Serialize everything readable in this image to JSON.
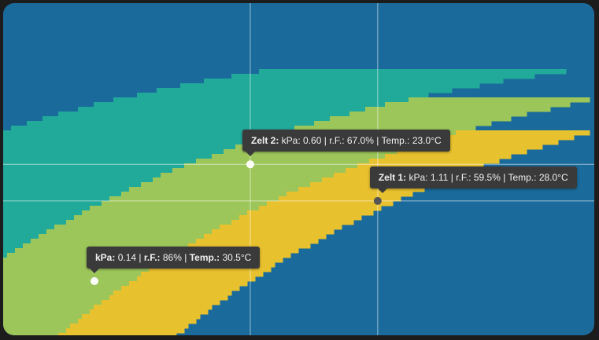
{
  "chart_data": {
    "type": "heatmap",
    "title": "",
    "xlabel": "",
    "ylabel": "",
    "x_variable": "Temp. (°C)",
    "y_variable": "r.F. (%)",
    "xlim": [
      13.3,
      36.5
    ],
    "ylim": [
      32,
      100
    ],
    "color_variable": "kPa",
    "bands": [
      {
        "color": "#1a6b9b",
        "vpd_range": [
          0.0,
          0.4
        ]
      },
      {
        "color": "#21a99a",
        "vpd_range": [
          0.4,
          0.8
        ]
      },
      {
        "color": "#9cc65a",
        "vpd_range": [
          0.8,
          1.2
        ]
      },
      {
        "color": "#e8c12e",
        "vpd_range": [
          1.2,
          1.6
        ]
      },
      {
        "color": "#cf4434",
        "vpd_range": [
          1.6,
          99
        ]
      }
    ],
    "points": [
      {
        "name": "Zelt 2",
        "kpa": 0.6,
        "rh": 67.0,
        "temp": 23.0,
        "color": "#ffffff"
      },
      {
        "name": "Zelt 1",
        "kpa": 1.11,
        "rh": 59.5,
        "temp": 28.0,
        "color": "#555555"
      },
      {
        "name": "",
        "kpa": 0.14,
        "rh": 86,
        "temp": 30.5,
        "color": "#ffffff"
      }
    ],
    "grid": false
  },
  "tooltips": {
    "zelt2": {
      "name": "Zelt 2:",
      "kpa_label": "kPa:",
      "kpa": "0.60",
      "rh_label": "r.F.:",
      "rh": "67.0%",
      "temp_label": "Temp.:",
      "temp": "23.0°C"
    },
    "zelt1": {
      "name": "Zelt 1:",
      "kpa_label": "kPa:",
      "kpa": "1.11",
      "rh_label": "r.F.:",
      "rh": "59.5%",
      "temp_label": "Temp.:",
      "temp": "28.0°C"
    },
    "cursor": {
      "kpa_label": "kPa:",
      "kpa": "0.14",
      "rh_label": "r.F.:",
      "rh": "86%",
      "temp_label": "Temp.:",
      "temp": "30.5°C"
    }
  },
  "colors": {
    "background": "#1c1c1c",
    "crosshair": "#ffffff",
    "tooltip": "#3a3a3a"
  }
}
